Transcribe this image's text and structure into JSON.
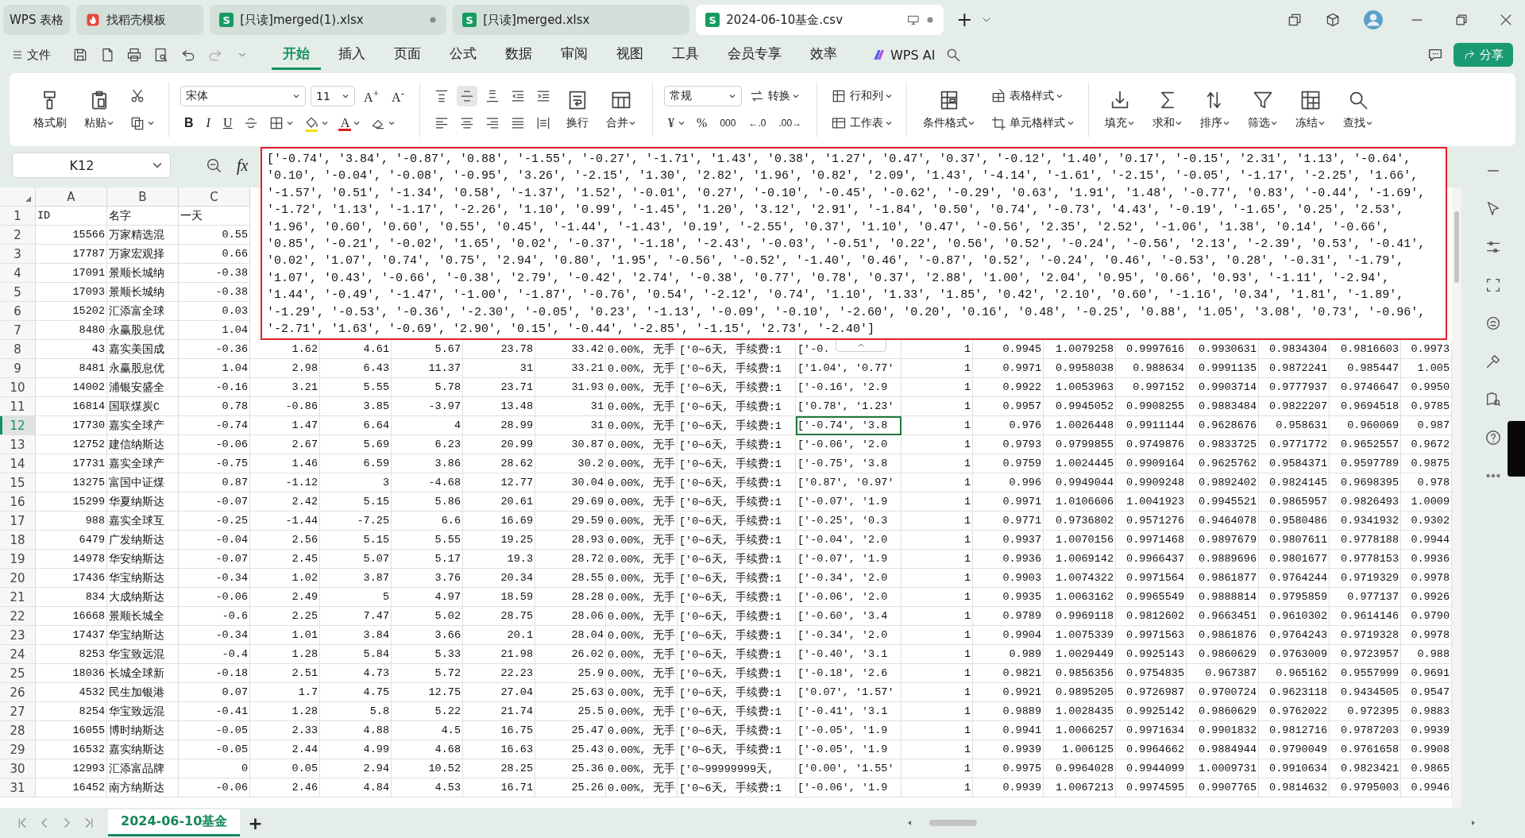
{
  "tabs": [
    {
      "label": "WPS 表格",
      "kind": "home",
      "modified": false,
      "selected": false
    },
    {
      "label": "找稻壳模板",
      "kind": "template",
      "modified": false,
      "selected": false
    },
    {
      "label": "[只读]merged(1).xlsx",
      "kind": "sheet",
      "badge": "S",
      "modified": true,
      "selected": false
    },
    {
      "label": "[只读]merged.xlsx",
      "kind": "sheet",
      "badge": "S",
      "modified": false,
      "selected": false
    },
    {
      "label": "2024-06-10基金.csv",
      "kind": "sheet",
      "badge": "S",
      "modified": true,
      "selected": true
    }
  ],
  "new_tab": "+",
  "menu": {
    "file": "文件",
    "tabs": [
      {
        "label": "开始",
        "selected": true
      },
      {
        "label": "插入",
        "selected": false
      },
      {
        "label": "页面",
        "selected": false
      },
      {
        "label": "公式",
        "selected": false
      },
      {
        "label": "数据",
        "selected": false
      },
      {
        "label": "审阅",
        "selected": false
      },
      {
        "label": "视图",
        "selected": false
      },
      {
        "label": "工具",
        "selected": false
      },
      {
        "label": "会员专享",
        "selected": false
      },
      {
        "label": "效率",
        "selected": false
      }
    ],
    "ai": "WPS AI",
    "share": "分享"
  },
  "ribbon": [
    [
      {
        "kind": "big",
        "label": "格式刷",
        "dropdown": false
      },
      {
        "kind": "big",
        "label": "粘贴",
        "dropdown": true
      },
      {
        "kind": "stack",
        "rows": [
          [
            {
              "kind": "button",
              "dropdown": false
            }
          ],
          [
            {
              "kind": "button",
              "dropdown": true
            }
          ]
        ]
      }
    ],
    [
      {
        "kind": "stack",
        "rows": [
          [
            {
              "kind": "select",
              "value": "宋体"
            },
            {
              "kind": "select",
              "value": "11"
            },
            {
              "kind": "text",
              "label": "A$^{+}$",
              "dropdown": false
            },
            {
              "kind": "text",
              "label": "A$^{-}$",
              "dropdown": false
            }
          ],
          [
            {
              "kind": "text",
              "label": "B",
              "dropdown": false
            },
            {
              "kind": "text",
              "label": "I",
              "dropdown": false
            },
            {
              "kind": "text",
              "label": "U",
              "dropdown": false
            },
            {
              "kind": "button",
              "dropdown": false
            },
            {
              "kind": "button",
              "dropdown": true
            },
            {
              "kind": "button",
              "color": "#f2e205",
              "dropdown": true
            },
            {
              "kind": "text",
              "label": "A",
              "color": "#e02020",
              "dropdown": true
            },
            {
              "kind": "button",
              "dropdown": true
            }
          ]
        ]
      }
    ],
    [
      {
        "kind": "stack",
        "rows": [
          [
            {
              "kind": "button",
              "dropdown": false,
              "selected": false
            },
            {
              "kind": "button",
              "dropdown": false,
              "selected": true
            },
            {
              "kind": "button",
              "dropdown": false,
              "selected": false
            },
            {
              "kind": "button",
              "dropdown": false,
              "selected": false
            },
            {
              "kind": "button",
              "dropdown": false,
              "selected": false
            }
          ],
          [
            {
              "kind": "button",
              "dropdown": false,
              "selected": false
            },
            {
              "kind": "button",
              "dropdown": false,
              "selected": false
            },
            {
              "kind": "button",
              "dropdown": false,
              "selected": false
            },
            {
              "kind": "button",
              "dropdown": false,
              "selected": false
            },
            {
              "kind": "button",
              "dropdown": false,
              "selected": false
            }
          ]
        ]
      },
      {
        "kind": "big",
        "label": "换行",
        "dropdown": false
      },
      {
        "kind": "big",
        "label": "合并",
        "dropdown": true
      }
    ],
    [
      {
        "kind": "stack",
        "rows": [
          [
            {
              "kind": "select",
              "value": "常规"
            },
            {
              "kind": "button",
              "label": "转换",
              "dropdown": true
            }
          ],
          [
            {
              "kind": "text",
              "label": "¥",
              "dropdown": true
            },
            {
              "kind": "text",
              "label": "%",
              "dropdown": false
            },
            {
              "kind": "text",
              "label": "000",
              "dropdown": false
            },
            {
              "kind": "text",
              "label": "←.0",
              "dropdown": false
            },
            {
              "kind": "text",
              "label": ".00→",
              "dropdown": false
            }
          ]
        ]
      }
    ],
    [
      {
        "kind": "stack",
        "rows": [
          [
            {
              "kind": "button",
              "label": "行和列",
              "dropdown": true
            }
          ],
          [
            {
              "kind": "button",
              "label": "工作表",
              "dropdown": true
            }
          ]
        ]
      }
    ],
    [
      {
        "kind": "big",
        "label": "条件格式",
        "dropdown": true
      },
      {
        "kind": "stack",
        "rows": [
          [
            {
              "kind": "button",
              "label": "表格样式",
              "dropdown": true
            }
          ],
          [
            {
              "kind": "button",
              "label": "单元格样式",
              "dropdown": true
            }
          ]
        ]
      }
    ],
    [
      {
        "kind": "big",
        "label": "填充",
        "dropdown": true
      },
      {
        "kind": "big",
        "label": "求和",
        "dropdown": true
      },
      {
        "kind": "big",
        "label": "排序",
        "dropdown": true
      },
      {
        "kind": "big",
        "label": "筛选",
        "dropdown": true
      },
      {
        "kind": "big",
        "label": "冻结",
        "dropdown": true
      },
      {
        "kind": "big",
        "label": "查找",
        "dropdown": true
      }
    ]
  ],
  "formula_bar": {
    "cell": "K12",
    "fx": "fx",
    "content": "['-0.74', '3.84', '-0.87', '0.88', '-1.55', '-0.27', '-1.71', '1.43', '0.38', '1.27', '0.47', '0.37', '-0.12', '1.40', '0.17', '-0.15', '2.31', '1.13', '-0.64', '0.10', '-0.04', '-0.08', '-0.95', '3.26', '-2.15', '1.30', '2.82', '1.96', '0.82', '2.09', '1.43', '-4.14', '-1.61', '-2.15', '-0.05', '-1.17', '-2.25', '1.66', '-1.57', '0.51', '-1.34', '0.58', '-1.37', '1.52', '-0.01', '0.27', '-0.10', '-0.45', '-0.62', '-0.29', '0.63', '1.91', '1.48', '-0.77', '0.83', '-0.44', '-1.69', '-1.72', '1.13', '-1.17', '-2.26', '1.10', '0.99', '-1.45', '1.20', '3.12', '2.91', '-1.84', '0.50', '0.74', '-0.73', '4.43', '-0.19', '-1.65', '0.25', '2.53', '1.96', '0.60', '0.60', '0.55', '0.45', '-1.44', '-1.43', '0.19', '-2.55', '0.37', '1.10', '0.47', '-0.56', '2.35', '2.52', '-1.06', '1.38', '0.14', '-0.66', '0.85', '-0.21', '-0.02', '1.65', '0.02', '-0.37', '-1.18', '-2.43', '-0.03', '-0.51', '0.22', '0.56', '0.52', '-0.24', '-0.56', '2.13', '-2.39', '0.53', '-0.41', '0.02', '1.07', '0.74', '0.75', '2.94', '0.80', '1.95', '-0.56', '-0.52', '-1.40', '0.46', '-0.87', '0.52', '-0.24', '0.46', '-0.53', '0.28', '-0.31', '-1.79', '1.07', '0.43', '-0.66', '-0.38', '2.79', '-0.42', '2.74', '-0.38', '0.77', '0.78', '0.37', '2.88', '1.00', '2.04', '0.95', '0.66', '0.93', '-1.11', '-2.94', '1.44', '-0.49', '-1.47', '-1.00', '-1.87', '-0.76', '0.54', '-2.12', '0.74', '1.10', '1.33', '1.85', '0.42', '2.10', '0.60', '-1.16', '0.34', '1.81', '-1.89', '-1.29', '-0.53', '-0.36', '-2.30', '-0.05', '0.23', '-1.13', '-0.09', '-0.10', '-2.60', '0.20', '0.16', '0.48', '-0.25', '0.88', '1.05', '3.08', '0.73', '-0.96', '-2.71', '1.63', '-0.69', '2.90', '0.15', '-0.44', '-2.85', '-1.15', '2.73', '-2.40']"
  },
  "grid": {
    "columns": [
      "A",
      "B",
      "C"
    ],
    "rows": [
      {
        "n": "1",
        "kind": "header",
        "selected": false,
        "cells": [
          "ID",
          "名字",
          "一天"
        ]
      },
      {
        "n": "2",
        "kind": "data",
        "selected": false,
        "cells": [
          "15566",
          "万家精选混",
          "0.55"
        ]
      },
      {
        "n": "3",
        "kind": "data",
        "selected": false,
        "cells": [
          "17787",
          "万家宏观择",
          "0.66"
        ]
      },
      {
        "n": "4",
        "kind": "data",
        "selected": false,
        "cells": [
          "17091",
          "景顺长城纳",
          "-0.38"
        ]
      },
      {
        "n": "5",
        "kind": "data",
        "selected": false,
        "cells": [
          "17093",
          "景顺长城纳",
          "-0.38"
        ]
      },
      {
        "n": "6",
        "kind": "data",
        "selected": false,
        "cells": [
          "15202",
          "汇添富全球",
          "0.03"
        ]
      },
      {
        "n": "7",
        "kind": "data",
        "selected": false,
        "cells": [
          "8480",
          "永赢股息优",
          "1.04"
        ]
      },
      {
        "n": "8",
        "kind": "data",
        "selected": false,
        "cells": [
          "43",
          "嘉实美国成",
          "-0.36",
          "1.62",
          "4.61",
          "5.67",
          "23.78",
          "33.42",
          "0.00%, 无手",
          "['0~6天, 手续费:1",
          "['-0.",
          "1",
          "0.9945",
          "1.0079258",
          "0.9997616",
          "0.9930631",
          "0.9834304",
          "0.9816603",
          "0.9973"
        ]
      },
      {
        "n": "9",
        "kind": "data",
        "selected": false,
        "cells": [
          "8481",
          "永赢股息优",
          "1.04",
          "2.98",
          "6.43",
          "11.37",
          "31",
          "33.21",
          "0.00%, 无手",
          "['0~6天, 手续费:1",
          "['1.04', '0.77'",
          "1",
          "0.9971",
          "0.9958038",
          "0.988634",
          "0.9991135",
          "0.9872241",
          "0.985447",
          "1.005"
        ]
      },
      {
        "n": "10",
        "kind": "data",
        "selected": false,
        "cells": [
          "14002",
          "浦银安盛全",
          "-0.16",
          "3.21",
          "5.55",
          "5.78",
          "23.71",
          "31.93",
          "0.00%, 无手",
          "['0~6天, 手续费:1",
          "['-0.16', '2.9",
          "1",
          "0.9922",
          "1.0053963",
          "0.997152",
          "0.9903714",
          "0.9777937",
          "0.9746647",
          "0.9950"
        ]
      },
      {
        "n": "11",
        "kind": "data",
        "selected": false,
        "cells": [
          "16814",
          "国联煤炭C",
          "0.78",
          "-0.86",
          "3.85",
          "-3.97",
          "13.48",
          "31",
          "0.00%, 无手",
          "['0~6天, 手续费:1",
          "['0.78', '1.23'",
          "1",
          "0.9957",
          "0.9945052",
          "0.9908255",
          "0.9883484",
          "0.9822207",
          "0.9694518",
          "0.9785"
        ]
      },
      {
        "n": "12",
        "kind": "data",
        "selected": true,
        "cells": [
          "17730",
          "嘉实全球产",
          "-0.74",
          "1.47",
          "6.64",
          "4",
          "28.99",
          "31",
          "0.00%, 无手",
          "['0~6天, 手续费:1",
          {
            "text": "['-0.74', '3.8",
            "selected": true
          },
          "1",
          "0.976",
          "1.0026448",
          "0.9911144",
          "0.9628676",
          "0.958631",
          "0.960069",
          "0.987"
        ]
      },
      {
        "n": "13",
        "kind": "data",
        "selected": false,
        "cells": [
          "12752",
          "建信纳斯达",
          "-0.06",
          "2.67",
          "5.69",
          "6.23",
          "20.99",
          "30.87",
          "0.00%, 无手",
          "['0~6天, 手续费:1",
          "['-0.06', '2.0",
          "1",
          "0.9793",
          "0.9799855",
          "0.9749876",
          "0.9833725",
          "0.9771772",
          "0.9652557",
          "0.9672"
        ]
      },
      {
        "n": "14",
        "kind": "data",
        "selected": false,
        "cells": [
          "17731",
          "嘉实全球产",
          "-0.75",
          "1.46",
          "6.59",
          "3.86",
          "28.62",
          "30.2",
          "0.00%, 无手",
          "['0~6天, 手续费:1",
          "['-0.75', '3.8",
          "1",
          "0.9759",
          "1.0024445",
          "0.9909164",
          "0.9625762",
          "0.9584371",
          "0.9597789",
          "0.9875"
        ]
      },
      {
        "n": "15",
        "kind": "data",
        "selected": false,
        "cells": [
          "13275",
          "富国中证煤",
          "0.87",
          "-1.12",
          "3",
          "-4.68",
          "12.77",
          "30.04",
          "0.00%, 无手",
          "['0~6天, 手续费:1",
          "['0.87', '0.97'",
          "1",
          "0.996",
          "0.9949044",
          "0.9909248",
          "0.9892402",
          "0.9824145",
          "0.9698395",
          "0.978"
        ]
      },
      {
        "n": "16",
        "kind": "data",
        "selected": false,
        "cells": [
          "15299",
          "华夏纳斯达",
          "-0.07",
          "2.42",
          "5.15",
          "5.86",
          "20.61",
          "29.69",
          "0.00%, 无手",
          "['0~6天, 手续费:1",
          "['-0.07', '1.9",
          "1",
          "0.9971",
          "1.0106606",
          "1.0041923",
          "0.9945521",
          "0.9865957",
          "0.9826493",
          "1.0009"
        ]
      },
      {
        "n": "17",
        "kind": "data",
        "selected": false,
        "cells": [
          "988",
          "嘉实全球互",
          "-0.25",
          "-1.44",
          "-7.25",
          "6.6",
          "16.69",
          "29.59",
          "0.00%, 无手",
          "['0~6天, 手续费:1",
          "['-0.25', '0.3",
          "1",
          "0.9771",
          "0.9736802",
          "0.9571276",
          "0.9464078",
          "0.9580486",
          "0.9341932",
          "0.9302"
        ]
      },
      {
        "n": "18",
        "kind": "data",
        "selected": false,
        "cells": [
          "6479",
          "广发纳斯达",
          "-0.04",
          "2.56",
          "5.15",
          "5.55",
          "19.25",
          "28.93",
          "0.00%, 无手",
          "['0~6天, 手续费:1",
          "['-0.04', '2.0",
          "1",
          "0.9937",
          "1.0070156",
          "0.9971468",
          "0.9897679",
          "0.9807611",
          "0.9778188",
          "0.9944"
        ]
      },
      {
        "n": "19",
        "kind": "data",
        "selected": false,
        "cells": [
          "14978",
          "华安纳斯达",
          "-0.07",
          "2.45",
          "5.07",
          "5.17",
          "19.3",
          "28.72",
          "0.00%, 无手",
          "['0~6天, 手续费:1",
          "['-0.07', '1.9",
          "1",
          "0.9936",
          "1.0069142",
          "0.9966437",
          "0.9889696",
          "0.9801677",
          "0.9778153",
          "0.9936"
        ]
      },
      {
        "n": "20",
        "kind": "data",
        "selected": false,
        "cells": [
          "17436",
          "华宝纳斯达",
          "-0.34",
          "1.02",
          "3.87",
          "3.76",
          "20.34",
          "28.55",
          "0.00%, 无手",
          "['0~6天, 手续费:1",
          "['-0.34', '2.0",
          "1",
          "0.9903",
          "1.0074322",
          "0.9971564",
          "0.9861877",
          "0.9764244",
          "0.9719329",
          "0.9978"
        ]
      },
      {
        "n": "21",
        "kind": "data",
        "selected": false,
        "cells": [
          "834",
          "大成纳斯达",
          "-0.06",
          "2.49",
          "5",
          "4.97",
          "18.59",
          "28.28",
          "0.00%, 无手",
          "['0~6天, 手续费:1",
          "['-0.06', '2.0",
          "1",
          "0.9935",
          "1.0063162",
          "0.9965549",
          "0.9888814",
          "0.9795859",
          "0.977137",
          "0.9926"
        ]
      },
      {
        "n": "22",
        "kind": "data",
        "selected": false,
        "cells": [
          "16668",
          "景顺长城全",
          "-0.6",
          "2.25",
          "7.47",
          "5.02",
          "28.75",
          "28.06",
          "0.00%, 无手",
          "['0~6天, 手续费:1",
          "['-0.60', '3.4",
          "1",
          "0.9789",
          "0.9969118",
          "0.9812602",
          "0.9663451",
          "0.9610302",
          "0.9614146",
          "0.9790"
        ]
      },
      {
        "n": "23",
        "kind": "data",
        "selected": false,
        "cells": [
          "17437",
          "华宝纳斯达",
          "-0.34",
          "1.01",
          "3.84",
          "3.66",
          "20.1",
          "28.04",
          "0.00%, 无手",
          "['0~6天, 手续费:1",
          "['-0.34', '2.0",
          "1",
          "0.9904",
          "1.0075339",
          "0.9971563",
          "0.9861876",
          "0.9764243",
          "0.9719328",
          "0.9978"
        ]
      },
      {
        "n": "24",
        "kind": "data",
        "selected": false,
        "cells": [
          "8253",
          "华宝致远混",
          "-0.4",
          "1.28",
          "5.84",
          "5.33",
          "21.98",
          "26.02",
          "0.00%, 无手",
          "['0~6天, 手续费:1",
          "['-0.40', '3.1",
          "1",
          "0.989",
          "1.0029449",
          "0.9925143",
          "0.9860629",
          "0.9763009",
          "0.9723957",
          "0.988"
        ]
      },
      {
        "n": "25",
        "kind": "data",
        "selected": false,
        "cells": [
          "18036",
          "长城全球新",
          "-0.18",
          "2.51",
          "4.73",
          "5.72",
          "22.23",
          "25.9",
          "0.00%, 无手",
          "['0~6天, 手续费:1",
          "['-0.18', '2.6",
          "1",
          "0.9821",
          "0.9856356",
          "0.9754835",
          "0.967387",
          "0.965162",
          "0.9557999",
          "0.9691"
        ]
      },
      {
        "n": "26",
        "kind": "data",
        "selected": false,
        "cells": [
          "4532",
          "民生加银港",
          "0.07",
          "1.7",
          "4.75",
          "12.75",
          "27.04",
          "25.63",
          "0.00%, 无手",
          "['0~6天, 手续费:1",
          "['0.07', '1.57'",
          "1",
          "0.9921",
          "0.9895205",
          "0.9726987",
          "0.9700724",
          "0.9623118",
          "0.9434505",
          "0.9547"
        ]
      },
      {
        "n": "27",
        "kind": "data",
        "selected": false,
        "cells": [
          "8254",
          "华宝致远混",
          "-0.41",
          "1.28",
          "5.8",
          "5.22",
          "21.74",
          "25.5",
          "0.00%, 无手",
          "['0~6天, 手续费:1",
          "['-0.41', '3.1",
          "1",
          "0.9889",
          "1.0028435",
          "0.9925142",
          "0.9860629",
          "0.9762022",
          "0.972395",
          "0.9883"
        ]
      },
      {
        "n": "28",
        "kind": "data",
        "selected": false,
        "cells": [
          "16055",
          "博时纳斯达",
          "-0.05",
          "2.33",
          "4.88",
          "4.5",
          "16.75",
          "25.47",
          "0.00%, 无手",
          "['0~6天, 手续费:1",
          "['-0.05', '1.9",
          "1",
          "0.9941",
          "1.0066257",
          "0.9971634",
          "0.9901832",
          "0.9812716",
          "0.9787203",
          "0.9939"
        ]
      },
      {
        "n": "29",
        "kind": "data",
        "selected": false,
        "cells": [
          "16532",
          "嘉实纳斯达",
          "-0.05",
          "2.44",
          "4.99",
          "4.68",
          "16.63",
          "25.43",
          "0.00%, 无手",
          "['0~6天, 手续费:1",
          "['-0.05', '1.9",
          "1",
          "0.9939",
          "1.006125",
          "0.9964662",
          "0.9884944",
          "0.9790049",
          "0.9761658",
          "0.9908"
        ]
      },
      {
        "n": "30",
        "kind": "data",
        "selected": false,
        "cells": [
          "12993",
          "汇添富品牌",
          "0",
          "0.05",
          "2.94",
          "10.52",
          "28.25",
          "25.36",
          "0.00%, 无手",
          "['0~99999999天,",
          "['0.00', '1.55'",
          "1",
          "0.9975",
          "0.9964028",
          "0.9944099",
          "1.0009731",
          "0.9910634",
          "0.9823421",
          "0.9865"
        ]
      },
      {
        "n": "31",
        "kind": "data",
        "selected": false,
        "cells": [
          "16452",
          "南方纳斯达",
          "-0.06",
          "2.46",
          "4.84",
          "4.53",
          "16.71",
          "25.26",
          "0.00%, 无手",
          "['0~6天, 手续费:1",
          "['-0.06', '1.9",
          "1",
          "0.9939",
          "1.0067213",
          "0.9974595",
          "0.9907765",
          "0.9814632",
          "0.9795003",
          "0.9946"
        ]
      }
    ]
  },
  "sheets": [
    {
      "label": "2024-06-10基金",
      "selected": true
    }
  ],
  "add_sheet": "+"
}
